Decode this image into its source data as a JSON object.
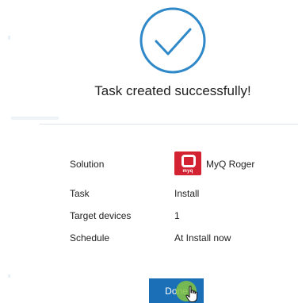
{
  "dialog": {
    "title": "Task created successfully!",
    "icon": "check-circle-icon",
    "accent_color": "#2f88c8"
  },
  "details": {
    "solution_label": "Solution",
    "solution_value": "MyQ Roger",
    "solution_logo_text": "myq",
    "solution_logo_color": "#d32231",
    "task_label": "Task",
    "task_value": "Install",
    "target_label": "Target devices",
    "target_value": "1",
    "schedule_label": "Schedule",
    "schedule_value": "At Install now"
  },
  "actions": {
    "done_label": "Done",
    "done_color": "#1b6fb6"
  },
  "cursor": {
    "icon": "hand-pointer-icon"
  }
}
